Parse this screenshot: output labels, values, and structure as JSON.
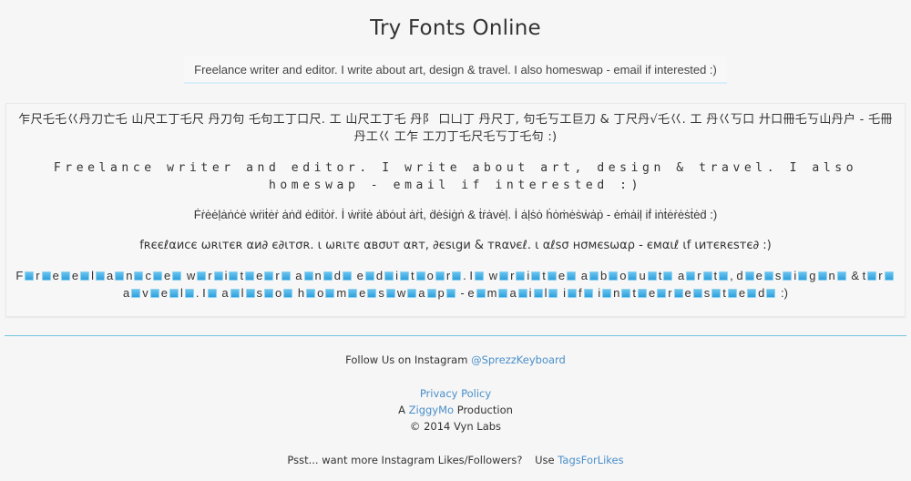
{
  "header": {
    "title": "Try Fonts Online"
  },
  "input": {
    "value": "Freelance writer and editor. I write about art, design & travel. I also homeswap - email if interested :)",
    "placeholder": ""
  },
  "results": [
    {
      "style": "cjk",
      "text": "乍尺乇乇巜丹刀亡乇 山尺工丁乇尺 丹刀句 乇句工丁口尺. 工 山尺工丁乇 丹阝 口凵丁 丹尺丁, 句乇丂工巨刀 & 丁尺丹√乇巜. 工 丹巜丂口 廾口冊乇丂山丹户 - 乇冊丹工巜 工乍 工刀丁乇尺乇丂丁乇句 :)"
    },
    {
      "style": "wide",
      "text": "Freelance writer and editor. I write about art, design & travel. I also homeswap - email if interested :)"
    },
    {
      "style": "dotted",
      "text": "Ḟṙėėḷȧṅċė ẇṙiṫėṙ ȧṅḋ ėḋiṫȯṙ. İ ẇṙiṫė ȧḃȯuṫ ȧṙṫ, ḋėṡiġṅ & ṫṙȧvėḷ. İ ȧḷṡȯ ḣȯṁėṡẇȧṗ - ėṁȧiḷ iḟ iṅṫėṙėṡṫėḋ :)"
    },
    {
      "style": "fancy",
      "text": "fʀєєℓαиϲє ωʀιтєʀ αи∂ є∂ιтσʀ. ι ωʀιтє αвσυт αʀт, ∂єѕιgи & тʀανєℓ. ι αℓѕσ нσмєѕωαρ - ємαιℓ ιf ιитєʀєѕтє∂ :)"
    },
    {
      "style": "boxed",
      "text": "Freelance writer and editor. I write about art, design & travel. I also homeswap - email if interested :)",
      "box_color": "#3aa8e0"
    }
  ],
  "footer": {
    "follow_prefix": "Follow Us on Instagram",
    "follow_link": "@SprezzKeyboard",
    "privacy_link": "Privacy Policy",
    "production_prefix": "A",
    "production_link": "ZiggyMo",
    "production_suffix": "Production",
    "copyright": "© 2014 Vyn Labs",
    "promo_text": "Psst... want more Instagram Likes/Followers?",
    "promo_use": "Use",
    "promo_link": "TagsForLikes"
  },
  "colors": {
    "link": "#4a8fc9",
    "divider": "#72c5dc",
    "input_underline": "#d8eef8"
  }
}
